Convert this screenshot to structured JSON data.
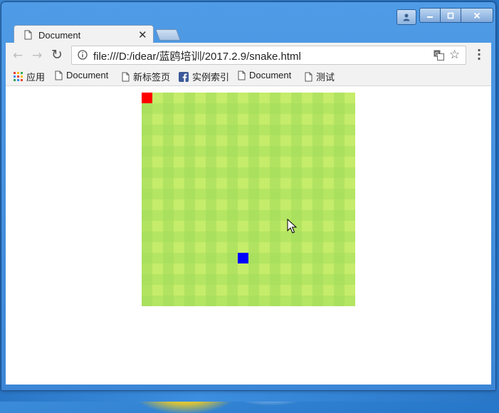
{
  "browser": {
    "tab": {
      "title": "Document"
    },
    "address_bar": {
      "url": "file:///D:/idear/蓝鸥培训/2017.2.9/snake.html"
    },
    "bookmarks": [
      {
        "label": "应用",
        "icon": "apps-grid-icon"
      },
      {
        "label": "Document",
        "icon": "page-icon"
      },
      {
        "label": "新标签页",
        "icon": "page-icon"
      },
      {
        "label": "实例索引",
        "icon": "facebook-icon"
      },
      {
        "label": "Document",
        "icon": "page-icon"
      },
      {
        "label": "测试",
        "icon": "page-icon"
      }
    ]
  },
  "game": {
    "board_color": "#c5ec6a",
    "food_color": "#ff0000",
    "snake_color": "#0000ff"
  }
}
